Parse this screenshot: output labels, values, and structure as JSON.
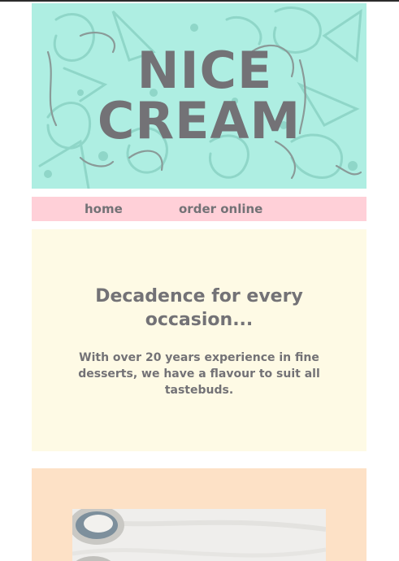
{
  "hero": {
    "title_line1": "Nice",
    "title_line2": "Cream"
  },
  "nav": {
    "items": [
      {
        "label": "home"
      },
      {
        "label": "order online"
      }
    ]
  },
  "intro": {
    "heading": "Decadence for every occasion...",
    "body": "With over 20 years experience in fine desserts, we have a flavour to suit all tastebuds."
  },
  "colors": {
    "hero_bg": "#aeeee2",
    "nav_bg": "#ffd0d8",
    "intro_bg": "#fefae5",
    "photo_section_bg": "#fde1c6",
    "text": "#737276"
  }
}
